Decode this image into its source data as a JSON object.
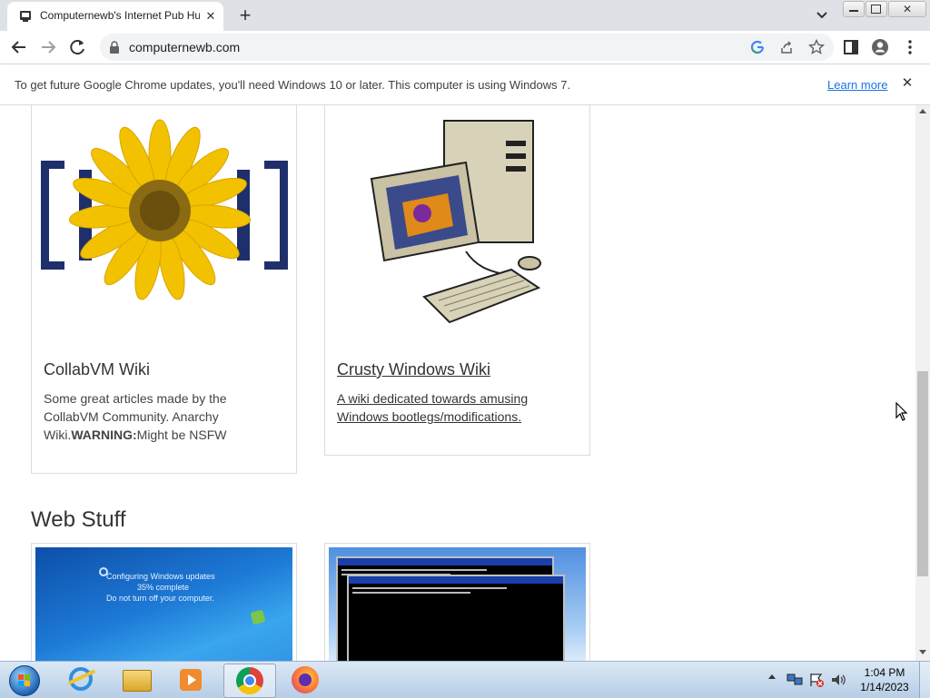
{
  "browser": {
    "tab_title": "Computernewb's Internet Pub Hub",
    "url": "computernewb.com",
    "infobar_message": "To get future Google Chrome updates, you'll need Windows 10 or later. This computer is using Windows 7.",
    "infobar_link": "Learn more"
  },
  "page": {
    "cards": [
      {
        "title": "CollabVM Wiki",
        "desc_before": "Some great articles made by the CollabVM Community. Anarchy Wiki.",
        "desc_bold": "WARNING:",
        "desc_after": "Might be NSFW",
        "image": "sunflower-logo"
      },
      {
        "title": "Crusty Windows Wiki",
        "desc": "A wiki dedicated towards amusing Windows bootlegs/modifications.",
        "image": "retro-computer"
      }
    ],
    "section_heading": "Web Stuff",
    "web_cards": [
      {
        "image": "windows-update-screen",
        "overlay_text": [
          "Configuring Windows updates",
          "35% complete",
          "Do not turn off your computer."
        ]
      },
      {
        "image": "command-prompt-windows"
      }
    ]
  },
  "taskbar": {
    "apps": [
      "start-button",
      "internet-explorer",
      "file-explorer",
      "media-player",
      "chrome",
      "firefox"
    ],
    "clock_time": "1:04 PM",
    "clock_date": "1/14/2023"
  },
  "colors": {
    "tab_strip": "#dee1e6",
    "link_blue": "#1a73e8",
    "taskbar": "#b6cde6"
  }
}
